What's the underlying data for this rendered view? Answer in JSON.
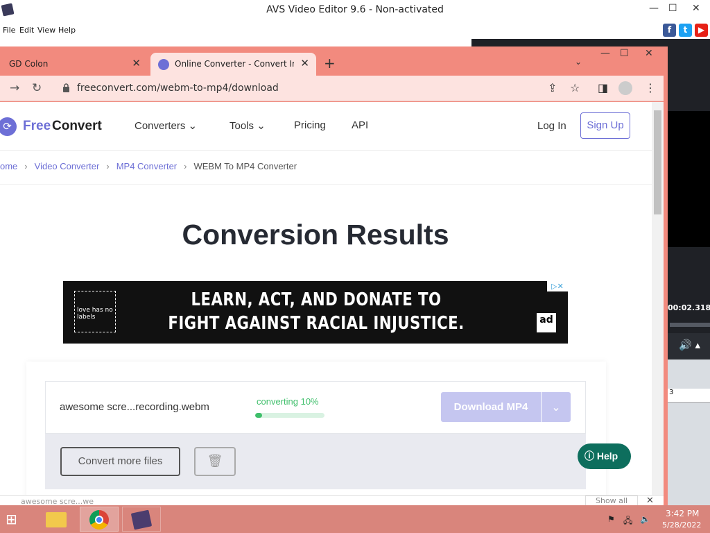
{
  "avs": {
    "title": "AVS Video Editor 9.6 - Non-activated",
    "menu": [
      "File",
      "Edit",
      "View",
      "Help"
    ],
    "timecode": "00:02.318",
    "timeline_mark": "3"
  },
  "browser": {
    "tabs": [
      {
        "label": "GD Colon"
      },
      {
        "label": "Online Converter - Convert Imag"
      }
    ],
    "url": "freeconvert.com/webm-to-mp4/download"
  },
  "site": {
    "logo_free": "Free",
    "logo_convert": "Convert",
    "nav": [
      "Converters",
      "Tools",
      "Pricing",
      "API"
    ],
    "login": "Log In",
    "signup": "Sign Up"
  },
  "breadcrumb": [
    "ome",
    "Video Converter",
    "MP4 Converter",
    "WEBM To MP4 Converter"
  ],
  "page_title": "Conversion Results",
  "ad": {
    "line1": "LEARN, ACT, AND DONATE TO",
    "line2": "FIGHT AGAINST RACIAL INJUSTICE.",
    "badge": "love has no labels",
    "council": "ad"
  },
  "file": {
    "name": "awesome scre...recording.webm",
    "status": "converting 10%",
    "progress": 0.1,
    "download_label": "Download MP4"
  },
  "actions": {
    "convert_more": "Convert more files"
  },
  "help_label": "Help",
  "downloads_bar": {
    "item": "awesome scre...we",
    "show_all": "Show all"
  },
  "clock": {
    "time": "3:42 PM",
    "date": "5/28/2022"
  },
  "colors": {
    "brand": "#6d6fd6",
    "progress": "#3fbf6b",
    "help": "#0d6e5d",
    "chrome_frame": "#f28a7e"
  }
}
